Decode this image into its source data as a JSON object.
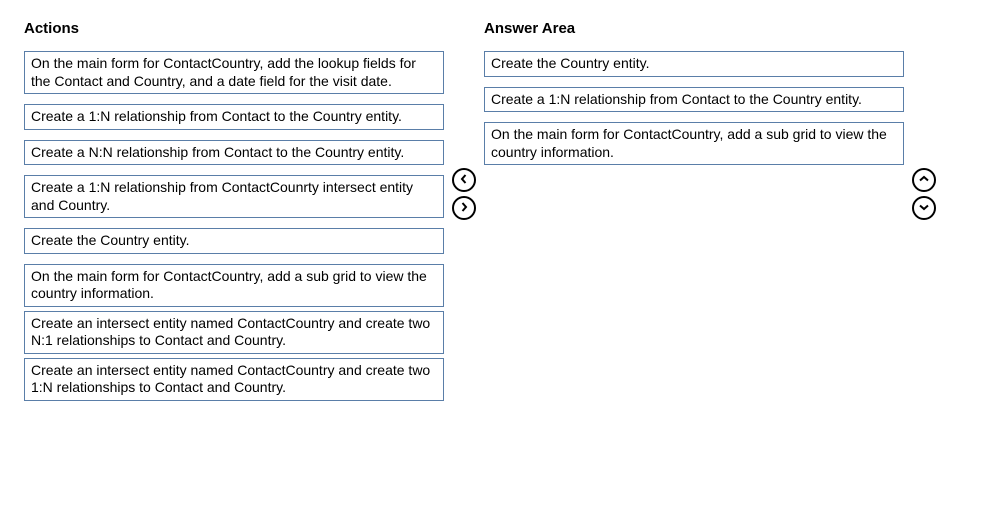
{
  "headers": {
    "actions": "Actions",
    "answer": "Answer Area"
  },
  "actions": [
    "On the main form for ContactCountry, add the lookup fields for the Contact and Country, and a date field for the visit date.",
    "Create a 1:N relationship from Contact to the Country entity.",
    "Create a N:N relationship from Contact to the Country entity.",
    "Create a 1:N relationship from ContactCounrty intersect entity and Country.",
    "Create the Country entity.",
    "On the main form for ContactCountry, add a sub grid to view the country information.",
    "Create an intersect entity named ContactCountry and create two N:1 relationships to Contact and Country.",
    "Create an intersect entity named ContactCountry and create two 1:N relationships to Contact and Country."
  ],
  "answers": [
    "Create the Country entity.",
    "Create a 1:N relationship from Contact to the Country entity.",
    "On the main form for ContactCountry, add a sub grid to view the country information."
  ]
}
